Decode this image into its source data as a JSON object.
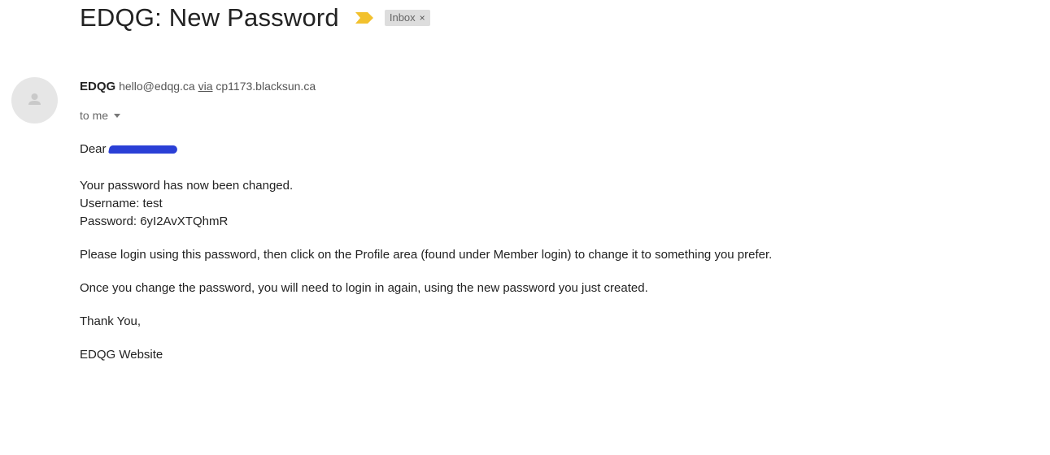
{
  "email": {
    "subject": "EDQG: New Password",
    "label": "Inbox",
    "label_remove": "×",
    "importance_color": "#f2c12e",
    "sender": {
      "name": "EDQG",
      "email": "hello@edqg.ca",
      "via_word": "via",
      "via_host": "cp1173.blacksun.ca"
    },
    "recipient": "to me",
    "body": {
      "greeting": "Dear",
      "line1": "Your password has now been changed.",
      "line2": "Username: test",
      "line3": "Password: 6yI2AvXTQhmR",
      "line4": "Please login using this password, then click on the Profile area (found under Member login) to change it to something you prefer.",
      "line5": "Once you change the password, you will need to login in again, using the new password you just created.",
      "closing": "Thank You,",
      "signature": "EDQG Website"
    }
  }
}
